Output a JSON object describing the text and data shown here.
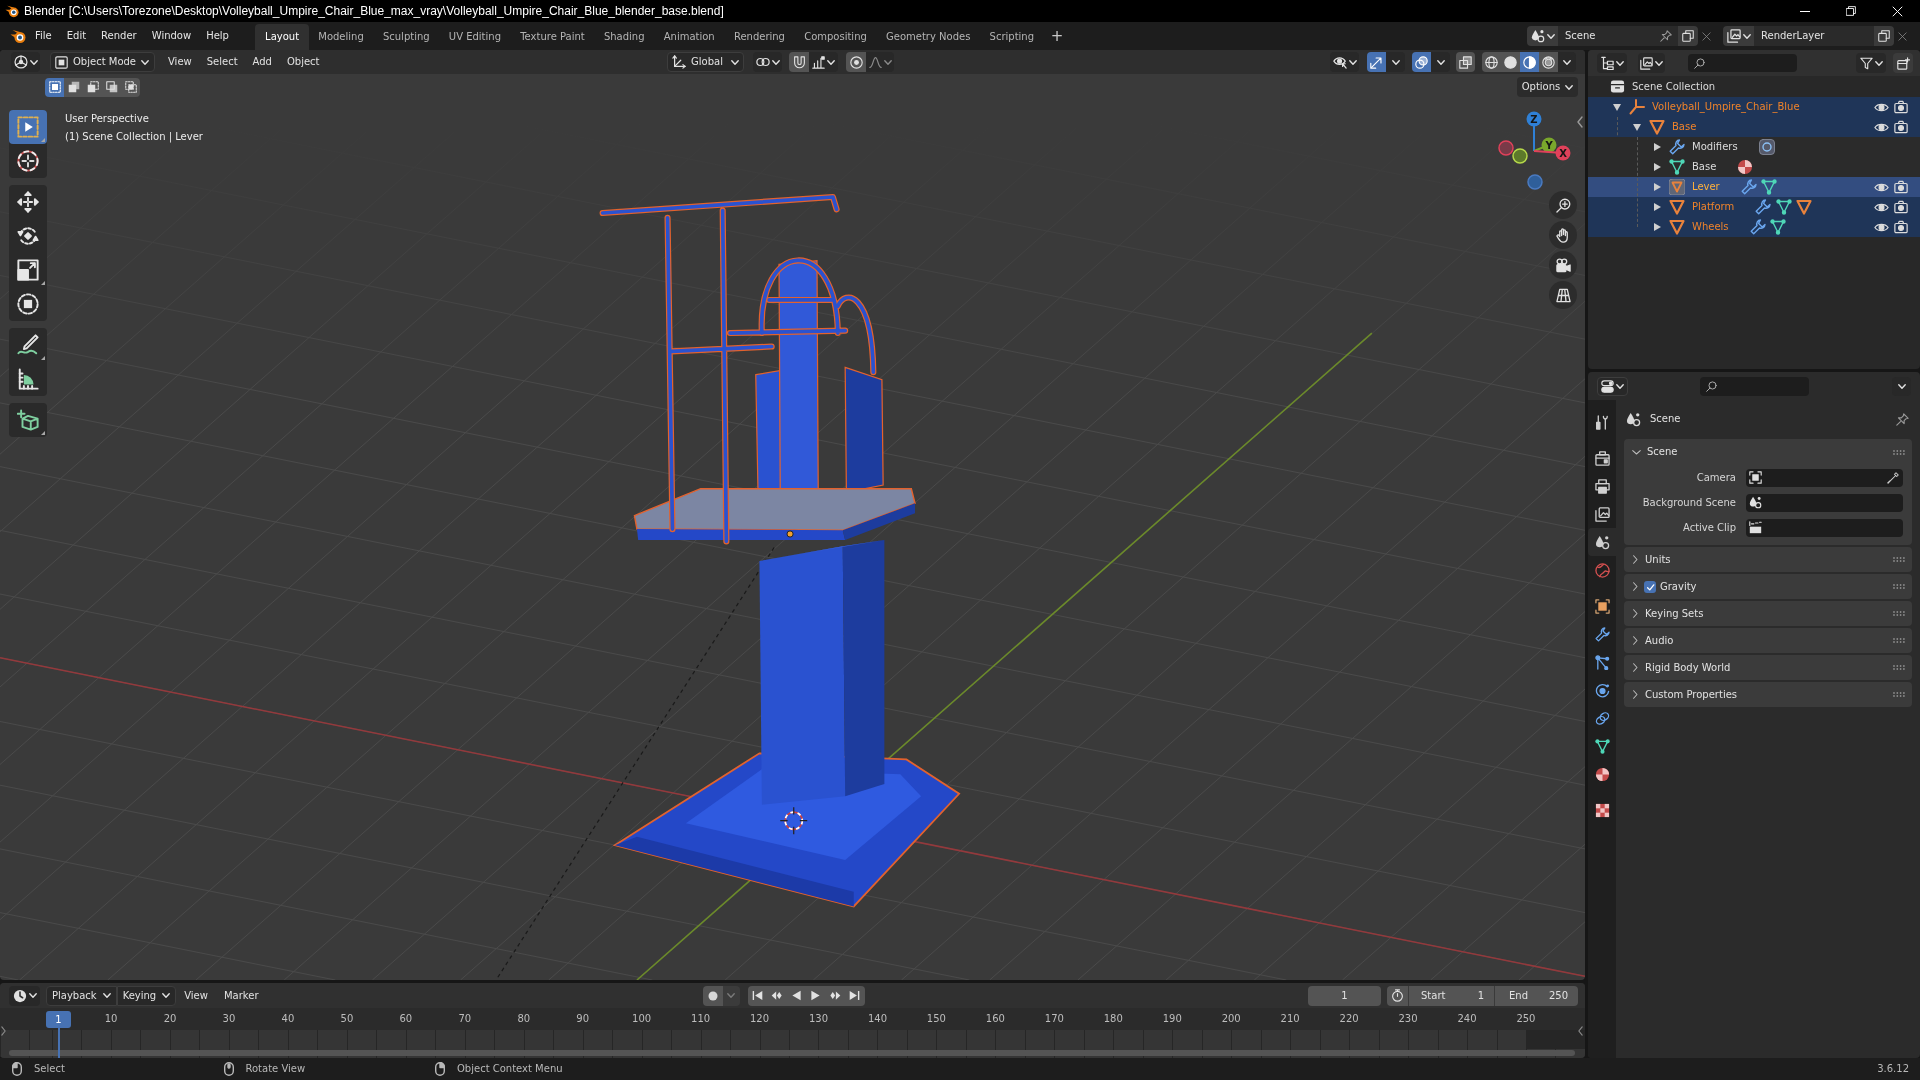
{
  "title_bar": {
    "title": "Blender [C:\\Users\\Torezone\\Desktop\\Volleyball_Umpire_Chair_Blue_max_vray\\Volleyball_Umpire_Chair_Blue_blender_base.blend]"
  },
  "menu_bar": [
    "File",
    "Edit",
    "Render",
    "Window",
    "Help"
  ],
  "workspace_tabs": [
    {
      "label": "Layout",
      "selected": true
    },
    {
      "label": "Modeling",
      "selected": false
    },
    {
      "label": "Sculpting",
      "selected": false
    },
    {
      "label": "UV Editing",
      "selected": false
    },
    {
      "label": "Texture Paint",
      "selected": false
    },
    {
      "label": "Shading",
      "selected": false
    },
    {
      "label": "Animation",
      "selected": false
    },
    {
      "label": "Rendering",
      "selected": false
    },
    {
      "label": "Compositing",
      "selected": false
    },
    {
      "label": "Geometry Nodes",
      "selected": false
    },
    {
      "label": "Scripting",
      "selected": false
    }
  ],
  "add_workspace": "+",
  "scene_selector": {
    "value": "Scene"
  },
  "view_layer_selector": {
    "value": "RenderLayer"
  },
  "viewport": {
    "mode": "Object Mode",
    "menus": [
      "View",
      "Select",
      "Add",
      "Object"
    ],
    "transform_orientation": "Global",
    "snapping": {
      "on": false
    },
    "proportional_editing": {
      "on": false
    },
    "gizmos": {
      "on": true
    },
    "overlays": {
      "on": true
    },
    "xray": {
      "on": false
    },
    "shading_modes": [
      {
        "kind": "wireframe",
        "selected": false
      },
      {
        "kind": "solid",
        "selected": false
      },
      {
        "kind": "material",
        "selected": true
      },
      {
        "kind": "rendered",
        "selected": false
      }
    ],
    "select_modes": [
      {
        "kind": "set",
        "selected": true
      },
      {
        "kind": "extend",
        "selected": false
      },
      {
        "kind": "subtract",
        "selected": false
      },
      {
        "kind": "invert",
        "selected": false
      },
      {
        "kind": "intersect",
        "selected": false
      }
    ],
    "options": "Options",
    "tool_groups": [
      [
        {
          "kind": "select_box",
          "selected": true,
          "more": true
        },
        {
          "kind": "cursor",
          "selected": false,
          "more": false
        }
      ],
      [
        {
          "kind": "move",
          "selected": false,
          "more": false
        },
        {
          "kind": "rotate",
          "selected": false,
          "more": false
        },
        {
          "kind": "scale",
          "selected": false,
          "more": true
        },
        {
          "kind": "transform",
          "selected": false,
          "more": false
        }
      ],
      [
        {
          "kind": "annotate",
          "selected": false,
          "more": true
        },
        {
          "kind": "measure",
          "selected": false,
          "more": false
        }
      ],
      [
        {
          "kind": "add_cube",
          "selected": false,
          "more": true
        }
      ]
    ],
    "info": [
      "User Perspective",
      "(1) Scene Collection | Lever"
    ],
    "navigation_gizmo": [
      {
        "kind": "z",
        "label": "Z"
      },
      {
        "kind": "y",
        "label": "Y"
      },
      {
        "kind": "x",
        "label": "X"
      }
    ]
  },
  "outliner": {
    "root": "Scene Collection",
    "items": [
      {
        "label": "Volleyball_Umpire_Chair_Blue",
        "kind": "empty",
        "expanded": true,
        "selected": true,
        "active": false,
        "children": [
          {
            "label": "Base",
            "kind": "mesh_object",
            "expanded": true,
            "selected": true,
            "active": false,
            "children": [
              {
                "label": "Modifiers",
                "kind": "modifiers",
                "expanded": false,
                "selected": false,
                "active": false,
                "badges": [
                  {
                    "kind": "modifier_item"
                  }
                ]
              },
              {
                "label": "Base",
                "kind": "mesh_data",
                "expanded": false,
                "selected": false,
                "active": false,
                "badges": [
                  {
                    "kind": "material"
                  }
                ]
              },
              {
                "label": "Lever",
                "kind": "mesh_object",
                "expanded": false,
                "selected": true,
                "active": true,
                "badges": [
                  {
                    "kind": "modifier"
                  },
                  {
                    "kind": "mesh_data"
                  }
                ]
              },
              {
                "label": "Platform",
                "kind": "mesh_object",
                "expanded": false,
                "selected": true,
                "active": false,
                "badges": [
                  {
                    "kind": "modifier"
                  },
                  {
                    "kind": "mesh_data"
                  },
                  {
                    "kind": "mesh_object"
                  }
                ]
              },
              {
                "label": "Wheels",
                "kind": "mesh_object",
                "expanded": false,
                "selected": true,
                "active": false,
                "badges": [
                  {
                    "kind": "modifier"
                  },
                  {
                    "kind": "mesh_data"
                  }
                ]
              }
            ]
          }
        ]
      }
    ]
  },
  "properties": {
    "tab_groups": [
      [
        {
          "kind": "tool",
          "selected": false
        }
      ],
      [
        {
          "kind": "render",
          "selected": false
        },
        {
          "kind": "output",
          "selected": false
        },
        {
          "kind": "view_layer",
          "selected": false
        },
        {
          "kind": "scene",
          "selected": true
        },
        {
          "kind": "world",
          "selected": false
        }
      ],
      [
        {
          "kind": "object",
          "selected": false
        },
        {
          "kind": "modifiers",
          "selected": false
        },
        {
          "kind": "particles",
          "selected": false
        },
        {
          "kind": "physics",
          "selected": false
        },
        {
          "kind": "constraints",
          "selected": false
        },
        {
          "kind": "data",
          "selected": false
        },
        {
          "kind": "material",
          "selected": false
        }
      ],
      [
        {
          "kind": "texture",
          "selected": false
        }
      ]
    ],
    "context": "Scene",
    "panels": [
      {
        "title": "Scene",
        "kind": "plain",
        "expanded": true,
        "fields": [
          {
            "label": "Camera",
            "kind": "camera"
          },
          {
            "label": "Background Scene",
            "kind": "scene"
          },
          {
            "label": "Active Clip",
            "kind": "clip"
          }
        ]
      },
      {
        "title": "Units",
        "kind": "plain",
        "expanded": false
      },
      {
        "title": "Gravity",
        "kind": "toggle",
        "checked": true,
        "expanded": false
      },
      {
        "title": "Keying Sets",
        "kind": "plain",
        "expanded": false
      },
      {
        "title": "Audio",
        "kind": "plain",
        "expanded": false
      },
      {
        "title": "Rigid Body World",
        "kind": "plain",
        "expanded": false
      },
      {
        "title": "Custom Properties",
        "kind": "plain",
        "expanded": false
      }
    ]
  },
  "timeline": {
    "menus": [
      {
        "label": "Playback",
        "dropdown": true
      },
      {
        "label": "Keying",
        "dropdown": true
      },
      {
        "label": "View",
        "dropdown": false
      },
      {
        "label": "Marker",
        "dropdown": false
      }
    ],
    "auto_keying": {
      "on": false
    },
    "current_frame": "1",
    "frame_start": {
      "label": "Start",
      "value": "1"
    },
    "frame_end": {
      "label": "End",
      "value": "250"
    },
    "playhead": "1",
    "ticks": [
      "10",
      "20",
      "30",
      "40",
      "50",
      "60",
      "70",
      "80",
      "90",
      "100",
      "110",
      "120",
      "130",
      "140",
      "150",
      "160",
      "170",
      "180",
      "190",
      "200",
      "210",
      "220",
      "230",
      "240",
      "250"
    ]
  },
  "status_bar": {
    "hints": [
      {
        "kind": "left_click",
        "label": "Select"
      },
      {
        "kind": "middle_click",
        "label": "Rotate View"
      },
      {
        "kind": "right_click",
        "label": "Object Context Menu"
      }
    ],
    "version": "3.6.12"
  }
}
